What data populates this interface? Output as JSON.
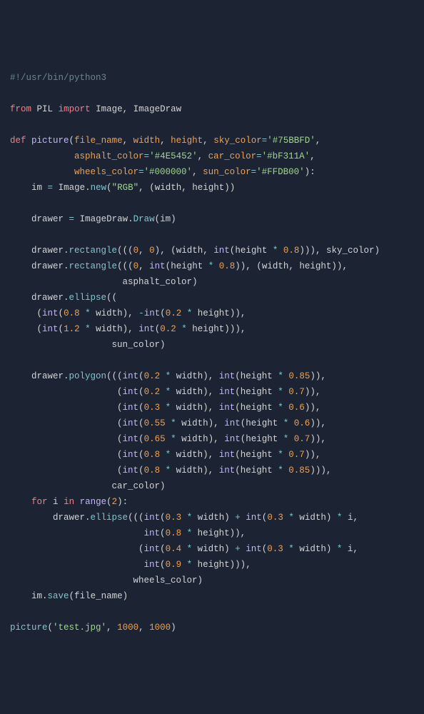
{
  "code": {
    "shebang": "#!/usr/bin/python3",
    "from": "from",
    "pil": "PIL",
    "import": "import",
    "image": "Image",
    "imagedraw": "ImageDraw",
    "def": "def",
    "picture": "picture",
    "file_name": "file_name",
    "width": "width",
    "height": "height",
    "sky_color": "sky_color",
    "sky_color_val": "'#75BBFD'",
    "asphalt_color": "asphalt_color",
    "asphalt_color_val": "'#4E5452'",
    "car_color": "car_color",
    "car_color_val": "'#bF311A'",
    "wheels_color": "wheels_color",
    "wheels_color_val": "'#000000'",
    "sun_color": "sun_color",
    "sun_color_val": "'#FFDB00'",
    "im": "im",
    "new": "new",
    "rgb": "\"RGB\"",
    "drawer": "drawer",
    "draw": "Draw",
    "rectangle": "rectangle",
    "int": "int",
    "zero": "0",
    "n08": "0.8",
    "ellipse": "ellipse",
    "n02": "0.2",
    "n12": "1.2",
    "polygon": "polygon",
    "n085": "0.85",
    "n07": "0.7",
    "n03": "0.3",
    "n06": "0.6",
    "n055": "0.55",
    "n065": "0.65",
    "for": "for",
    "i": "i",
    "in": "in",
    "range": "range",
    "two": "2",
    "n04": "0.4",
    "n09": "0.9",
    "save": "save",
    "testjpg": "'test.jpg'",
    "thousand": "1000",
    "star": "*",
    "minus": "-",
    "plus": "+",
    "eq": "=",
    "comma": ",",
    "colon": ":",
    "dot": ".",
    "lp": "(",
    "rp": ")"
  }
}
